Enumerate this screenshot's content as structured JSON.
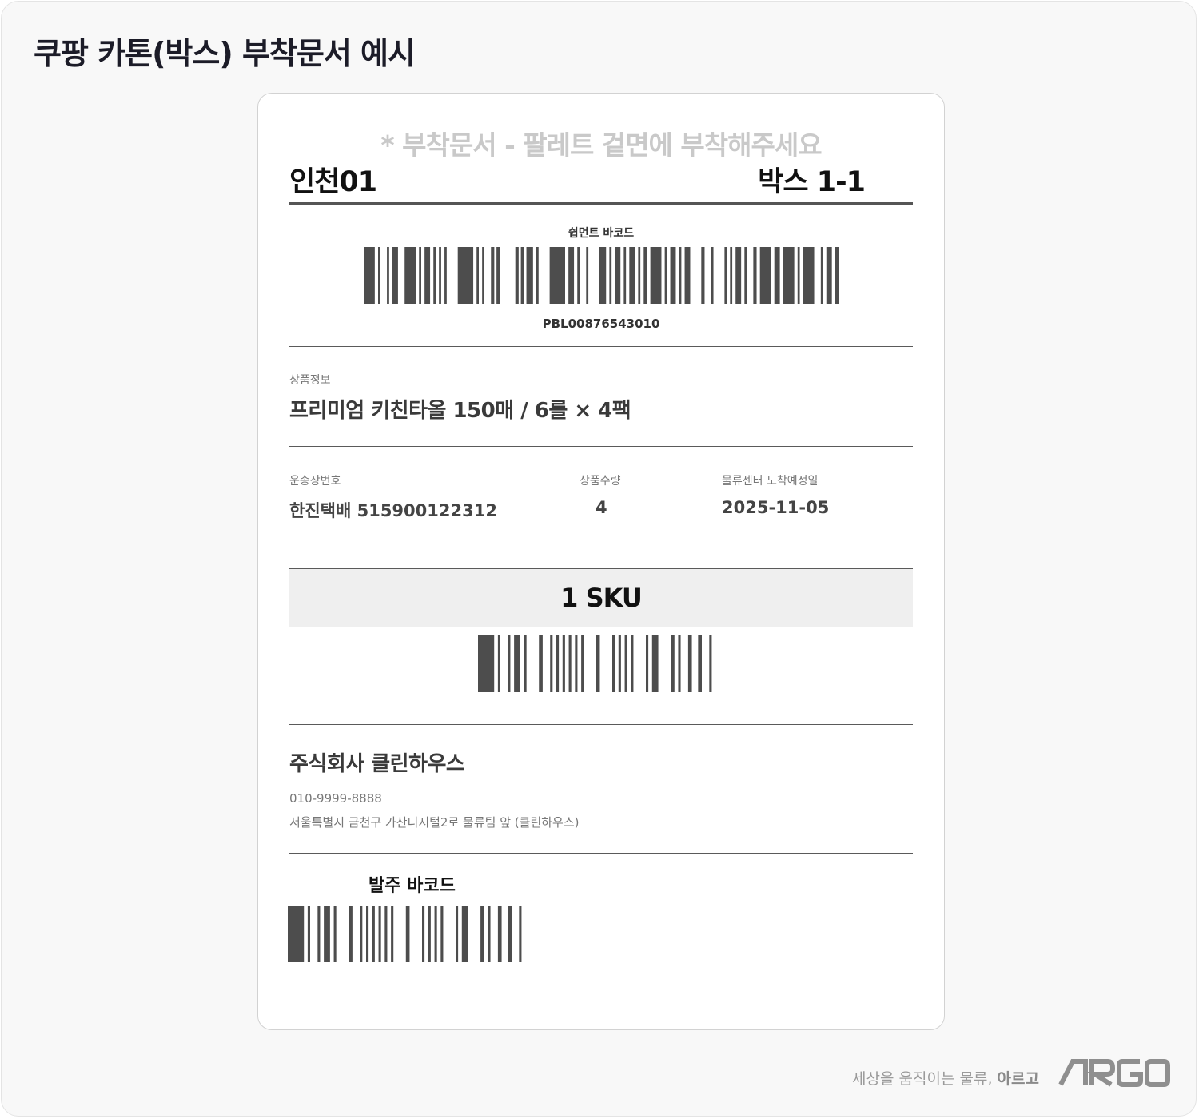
{
  "page": {
    "title": "쿠팡 카톤(박스) 부착문서 예시"
  },
  "label": {
    "notice": "* 부착문서 - 팔레트 겉면에 부착해주세요",
    "center": "인천01",
    "box": "박스 1-1",
    "shipment": {
      "title": "쉽먼트 바코드",
      "code": "PBL00876543010",
      "bars": [
        10,
        3,
        2,
        6,
        2,
        3,
        5,
        6,
        10,
        3,
        2,
        3,
        5,
        3,
        2,
        3,
        2,
        3,
        2,
        10,
        14,
        3,
        2,
        3,
        2,
        6,
        3,
        2,
        3,
        14,
        3,
        2,
        3,
        2,
        6,
        3,
        2,
        10,
        14,
        3,
        5,
        3,
        2,
        6,
        2,
        10,
        6,
        3,
        2,
        3,
        5,
        3,
        2,
        3,
        5,
        3,
        2,
        3,
        3,
        3,
        10,
        3,
        2,
        3,
        5,
        3,
        2,
        3,
        5,
        10,
        3,
        6,
        2,
        10,
        2,
        3,
        2,
        3,
        5,
        3,
        2,
        6,
        3,
        3,
        10,
        3,
        5,
        3,
        10,
        3,
        2,
        3,
        10,
        6,
        2,
        3,
        5,
        3,
        3
      ]
    },
    "product_label": "상품정보",
    "product": "프리미엄 키친타올 150매 / 6롤 × 4팩",
    "tracking_label": "운송장번호",
    "tracking": "한진택배 515900122312",
    "qty_label": "상품수량",
    "qty": "4",
    "eta_label": "물류센터 도착예정일",
    "eta": "2025-11-05",
    "sku": "1 SKU",
    "sku_bars": [
      13,
      3,
      2,
      6,
      2,
      3,
      5,
      3,
      2,
      10,
      3,
      6,
      2,
      3,
      2,
      3,
      2,
      3,
      2,
      3,
      2,
      3,
      2,
      10,
      3,
      10,
      2,
      3,
      2,
      3,
      2,
      3,
      2,
      10,
      2,
      3,
      5,
      10,
      3,
      3,
      2,
      6,
      3,
      5,
      3,
      6,
      2,
      10
    ],
    "company": "주식회사 클린하우스",
    "phone": "010-9999-8888",
    "address": "서울특별시 금천구 가산디지털2로 물류팀 앞 (클린하우스)",
    "po_label": "발주 바코드",
    "po_bars": [
      13,
      3,
      2,
      6,
      2,
      3,
      5,
      3,
      2,
      10,
      3,
      6,
      2,
      3,
      2,
      3,
      2,
      3,
      2,
      3,
      2,
      3,
      2,
      10,
      3,
      10,
      2,
      3,
      2,
      3,
      2,
      3,
      2,
      10,
      2,
      3,
      5,
      10,
      3,
      3,
      2,
      6,
      3,
      5,
      3,
      6,
      2,
      10
    ]
  },
  "footer": {
    "slogan": "세상을 움직이는 물류,",
    "slogan_brand": "아르고",
    "logo": "ARGO"
  },
  "colors": {
    "bar": "#4d4d4d",
    "title": "#1c1c28",
    "notice": "#c9c9c9"
  }
}
